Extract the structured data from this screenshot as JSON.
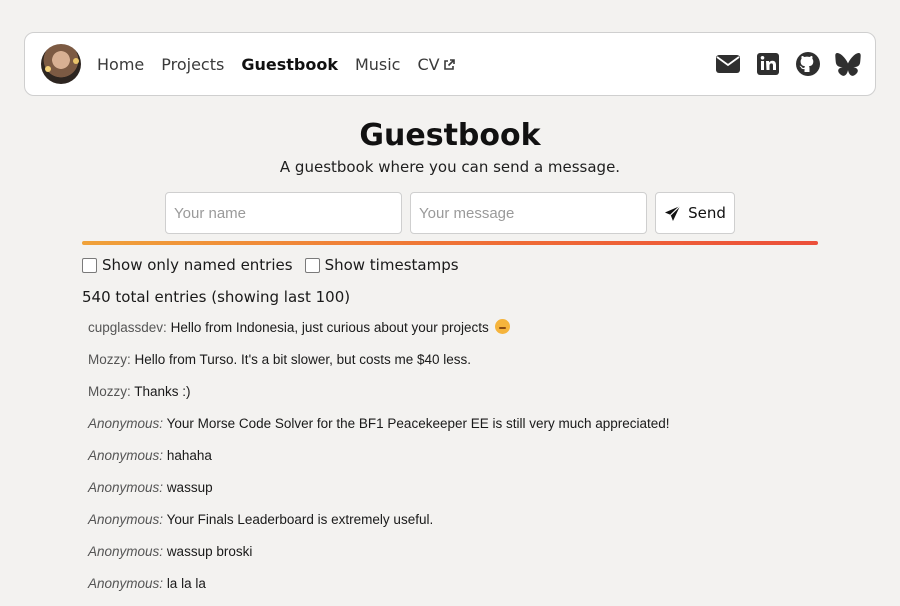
{
  "nav": {
    "links": [
      {
        "label": "Home"
      },
      {
        "label": "Projects"
      },
      {
        "label": "Guestbook"
      },
      {
        "label": "Music"
      },
      {
        "label": "CV"
      }
    ],
    "active": "Guestbook",
    "socials": [
      "envelope-icon",
      "linkedin-icon",
      "github-icon",
      "bluesky-icon"
    ]
  },
  "page": {
    "title": "Guestbook",
    "subtitle": "A guestbook where you can send a message."
  },
  "form": {
    "name_placeholder": "Your name",
    "message_placeholder": "Your message",
    "send_label": "Send"
  },
  "filters": {
    "named_only_label": "Show only named entries",
    "timestamps_label": "Show timestamps"
  },
  "summary": "540 total entries (showing last 100)",
  "entries": [
    {
      "name": "cupglassdev:",
      "message": "Hello from Indonesia, just curious about your projects",
      "anonymous": false
    },
    {
      "name": "Mozzy:",
      "message": "Hello from Turso. It's a bit slower, but costs me $40 less.",
      "anonymous": false
    },
    {
      "name": "Mozzy:",
      "message": "Thanks :)",
      "anonymous": false
    },
    {
      "name": "Anonymous:",
      "message": "Your Morse Code Solver for the BF1 Peacekeeper EE is still very much appreciated!",
      "anonymous": true
    },
    {
      "name": "Anonymous:",
      "message": "hahaha",
      "anonymous": true
    },
    {
      "name": "Anonymous:",
      "message": "wassup",
      "anonymous": true
    },
    {
      "name": "Anonymous:",
      "message": "Your Finals Leaderboard is extremely useful.",
      "anonymous": true
    },
    {
      "name": "Anonymous:",
      "message": "wassup broski",
      "anonymous": true
    },
    {
      "name": "Anonymous:",
      "message": "la la la",
      "anonymous": true
    }
  ],
  "colors": {
    "background": "#f3f2f0",
    "accent_start": "#f0a23a",
    "accent_end": "#ec4f3a"
  }
}
